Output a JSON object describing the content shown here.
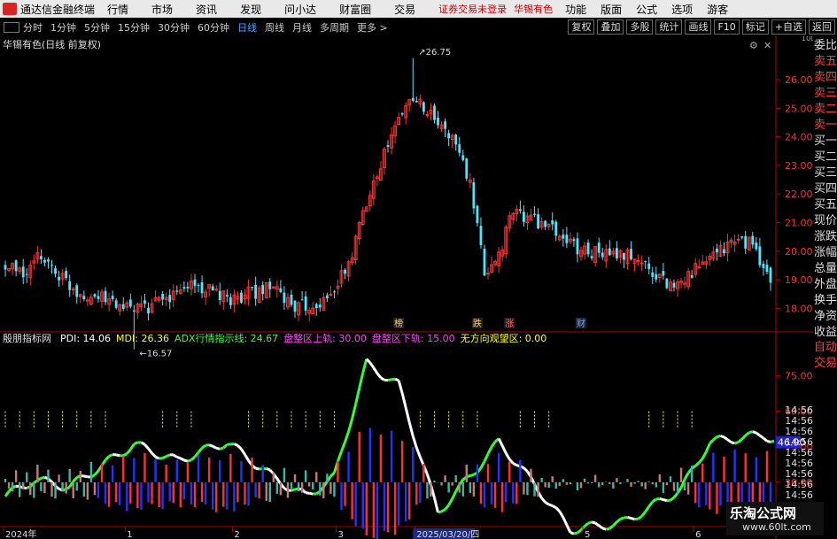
{
  "menubar": {
    "app_name": "通达信金融终端",
    "items": [
      "行情",
      "市场",
      "资讯",
      "发现",
      "问小达",
      "财富圈",
      "交易"
    ],
    "notice": "证券交易未登录",
    "stock": "华锡有色",
    "right_items": [
      "功能",
      "版面",
      "公式",
      "选项"
    ],
    "guest": "游客"
  },
  "toolbar": {
    "timeframes": [
      "分时",
      "1分钟",
      "5分钟",
      "15分钟",
      "30分钟",
      "60分钟",
      "日线",
      "周线",
      "月线",
      "多周期",
      "更多 >"
    ],
    "active_index": 6,
    "buttons": [
      "复权",
      "叠加",
      "多股",
      "统计",
      "画线",
      "F10",
      "标记",
      "+自选",
      "返回"
    ]
  },
  "sidepanel": {
    "top_items": [
      "委比",
      "卖五",
      "卖四",
      "卖三",
      "卖二",
      "卖一",
      "买一",
      "买二",
      "买三",
      "买四",
      "买五",
      "现价",
      "涨跌",
      "涨幅",
      "总量",
      "外盘",
      "换手",
      "净资",
      "收益"
    ],
    "bottom_items": [
      "自动",
      "交易"
    ]
  },
  "watermark": {
    "line1": "乐淘公式网",
    "line2": "www.60lt.com"
  },
  "colors": {
    "up": "#ff3030",
    "down": "#4de6ff",
    "yellow": "#ffff00",
    "purple": "#ff40ff",
    "pdi": "#ffffff",
    "adx_green": "#33ff33"
  },
  "chart_data": [
    {
      "type": "candlestick",
      "title": "华锡有色(日线 前复权)",
      "ylim": [
        17.3,
        26.9
      ],
      "yticks": [
        18.0,
        19.0,
        20.0,
        21.0,
        22.0,
        23.0,
        24.0,
        25.0,
        26.0
      ],
      "y_unit": "1000",
      "annotations": [
        {
          "index": 114,
          "text": "26.75"
        },
        {
          "index": 36,
          "text": "16.57"
        }
      ],
      "event_tags": [
        {
          "index": 110,
          "text": "榜"
        },
        {
          "index": 132,
          "text": "跌"
        },
        {
          "index": 141,
          "text": "涨"
        },
        {
          "index": 161,
          "text": "财"
        }
      ],
      "series_params": {
        "n": 215,
        "start": 19.4,
        "seed": 5
      },
      "series": []
    },
    {
      "type": "line",
      "title": "殷朋指标网",
      "legend": [
        {
          "label": "PDI: 14.06",
          "color": "#ffffff"
        },
        {
          "label": "MDI: 26.36",
          "color": "#ffff00"
        },
        {
          "label": "ADX行情指示线: 24.67",
          "color": "#33ff33"
        },
        {
          "label": "盘整区上轨: 30.00",
          "color": "#ff40ff"
        },
        {
          "label": "盘整区下轨: 15.00",
          "color": "#ff40ff"
        },
        {
          "label": "无方向观望区: 0.00",
          "color": "#ffff00"
        }
      ],
      "ylim": [
        12,
        86
      ],
      "yticks": [
        15.0,
        30.0,
        45.0,
        60.0,
        75.0
      ],
      "current_value": "46.90",
      "right_ticks": [
        "14:56",
        "14:56",
        "14:56",
        "14:56",
        "14:56",
        "14:56",
        "14:56",
        "14:56",
        "14:56",
        "14:56",
        "14:56"
      ],
      "x_ticks": [
        {
          "index": 0,
          "text": "2024年"
        },
        {
          "index": 34,
          "text": "1"
        },
        {
          "index": 64,
          "text": "2"
        },
        {
          "index": 93,
          "text": "3"
        },
        {
          "index": 115,
          "text": "2025/03/20/四",
          "highlight": true
        },
        {
          "index": 162,
          "text": "5"
        },
        {
          "index": 193,
          "text": "6"
        }
      ],
      "adx_anchors": [
        [
          0,
          24
        ],
        [
          8,
          31
        ],
        [
          18,
          28
        ],
        [
          36,
          46
        ],
        [
          48,
          39
        ],
        [
          62,
          47
        ],
        [
          75,
          32
        ],
        [
          84,
          24
        ],
        [
          92,
          32
        ],
        [
          101,
          80
        ],
        [
          110,
          71
        ],
        [
          121,
          17
        ],
        [
          132,
          36
        ],
        [
          138,
          47
        ],
        [
          148,
          29
        ],
        [
          158,
          10
        ],
        [
          173,
          13
        ],
        [
          189,
          27
        ],
        [
          197,
          47
        ],
        [
          212,
          50
        ],
        [
          215,
          48
        ]
      ],
      "pdi_anchors": [
        [
          0,
          24
        ],
        [
          8,
          31
        ],
        [
          18,
          28
        ],
        [
          36,
          46
        ],
        [
          48,
          39
        ],
        [
          62,
          47
        ],
        [
          75,
          32
        ],
        [
          84,
          24
        ],
        [
          92,
          32
        ],
        [
          101,
          80
        ],
        [
          110,
          71
        ],
        [
          121,
          17
        ],
        [
          132,
          36
        ],
        [
          138,
          47
        ],
        [
          148,
          29
        ],
        [
          158,
          10
        ],
        [
          173,
          13
        ],
        [
          189,
          27
        ],
        [
          197,
          47
        ],
        [
          212,
          50
        ],
        [
          215,
          48
        ]
      ],
      "series": []
    }
  ]
}
